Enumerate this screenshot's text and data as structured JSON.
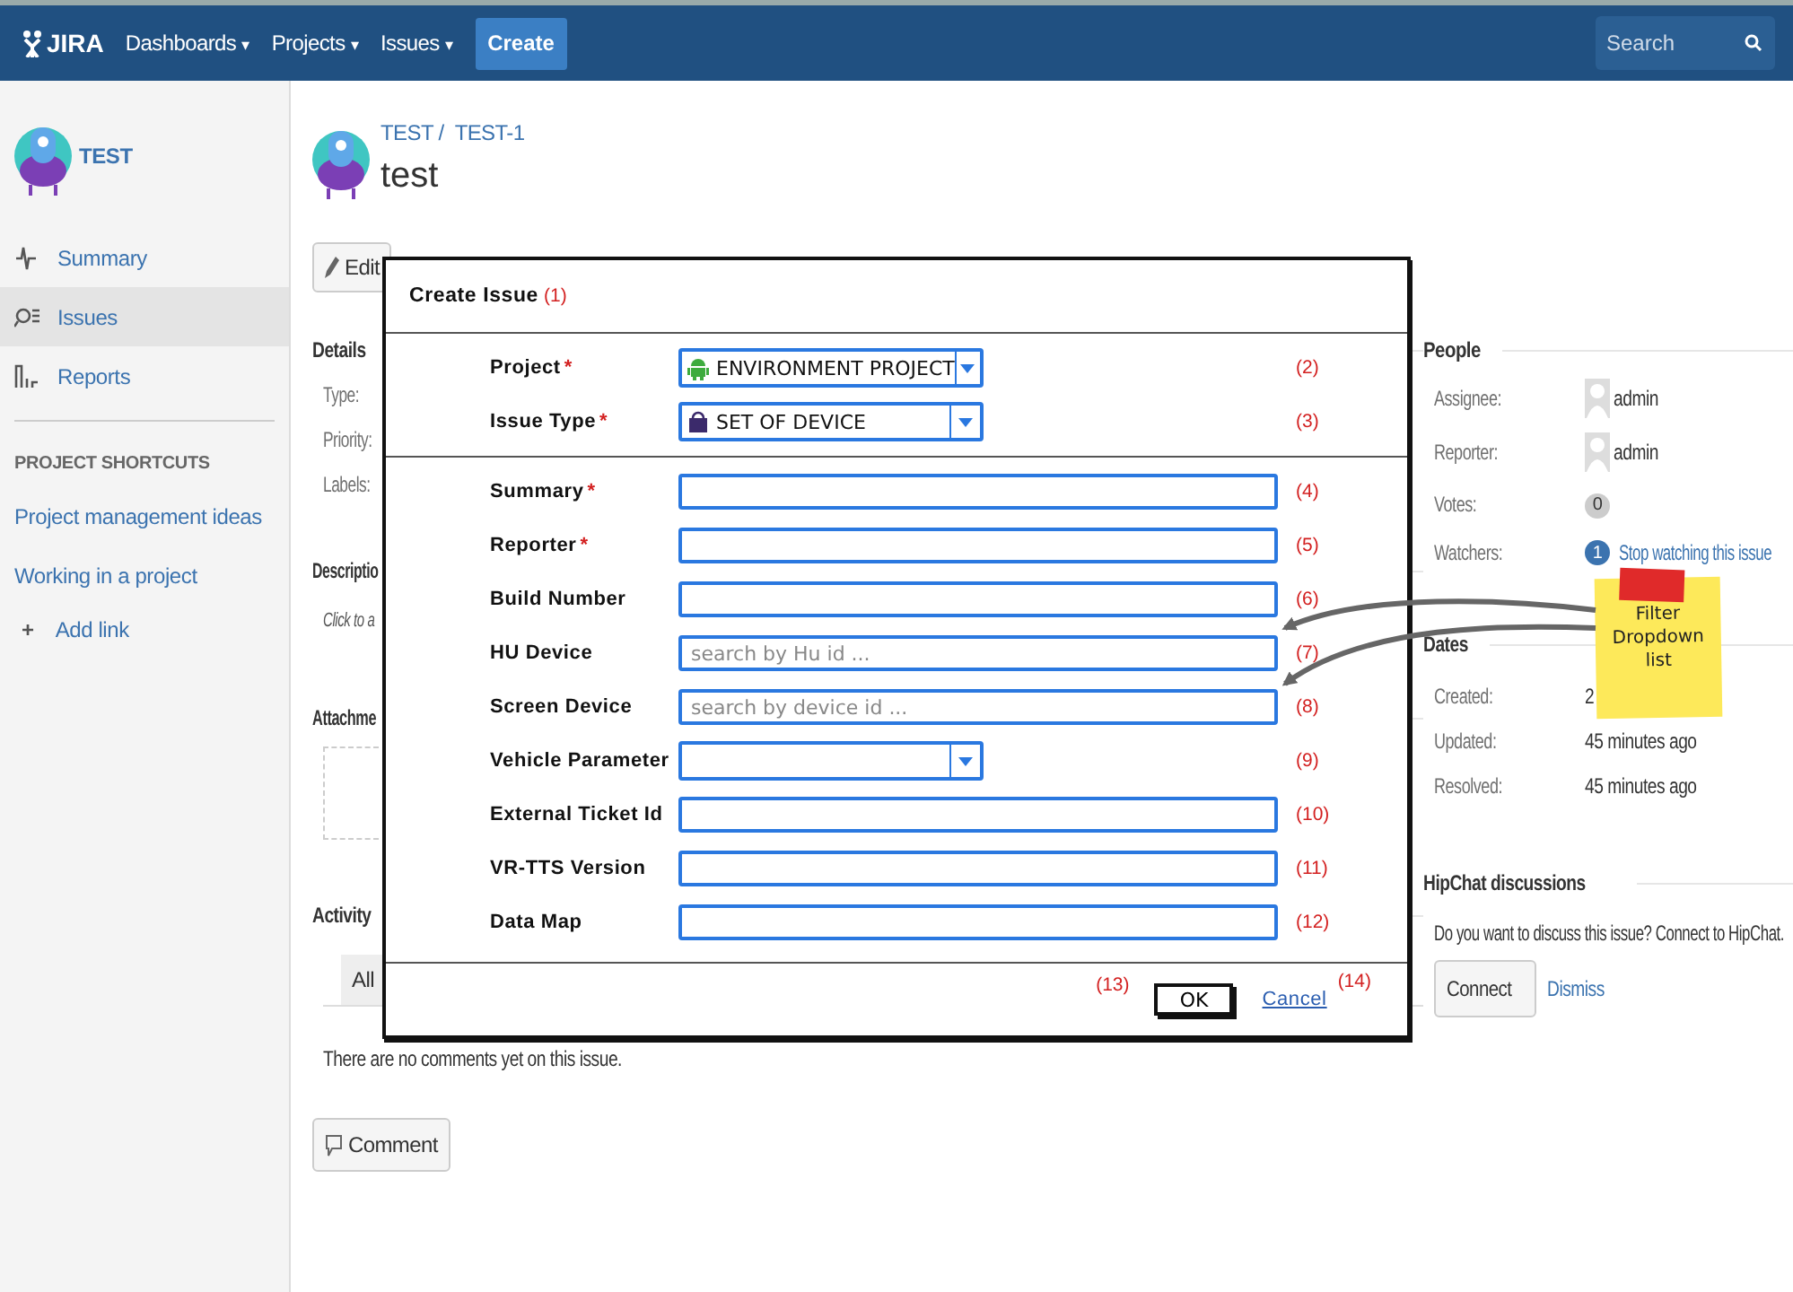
{
  "top_nav": {
    "logo": "JIRA",
    "menus": [
      {
        "label": "Dashboards",
        "caret": "▾"
      },
      {
        "label": "Projects",
        "caret": "▾"
      },
      {
        "label": "Issues",
        "caret": "▾"
      }
    ],
    "create_button": "Create",
    "search": {
      "placeholder": "Search"
    }
  },
  "sidebar": {
    "project_name": "TEST",
    "nav": [
      {
        "label": "Summary",
        "kind": "pulse",
        "selected": false
      },
      {
        "label": "Issues",
        "kind": "search",
        "selected": true
      },
      {
        "label": "Reports",
        "kind": "chart",
        "selected": false
      }
    ],
    "shortcuts_heading": "PROJECT SHORTCUTS",
    "shortcuts": [
      "Project management ideas",
      "Working in a project"
    ],
    "add_link": {
      "icon": "+",
      "label": "Add link"
    }
  },
  "issue": {
    "breadcrumb": {
      "project": "TEST",
      "separator": "/",
      "key": "TEST-1"
    },
    "title": "test",
    "toolbar": [
      "Edit"
    ],
    "details": {
      "heading": "Details",
      "labels": [
        "Type:",
        "Priority:",
        "Labels:"
      ]
    },
    "description": {
      "heading": "Descriptio",
      "prompt": "Click to a"
    },
    "attachments": {
      "heading": "Attachme"
    },
    "activity": {
      "heading": "Activity",
      "tabs": [
        {
          "label": "All",
          "selected": true
        }
      ],
      "message": "There are no comments yet on this issue.",
      "comment_button": "Comment"
    },
    "people": {
      "heading": "People",
      "rows": [
        {
          "label": "Assignee:",
          "kind": "user",
          "value": "admin"
        },
        {
          "label": "Reporter:",
          "kind": "user",
          "value": "admin"
        },
        {
          "label": "Votes:",
          "kind": "count",
          "value": "0"
        },
        {
          "label": "Watchers:",
          "kind": "watch",
          "badge": "1",
          "value": "Stop watching this issue"
        }
      ]
    },
    "dates": {
      "heading": "Dates",
      "rows": [
        {
          "label": "Created:",
          "value": "2"
        },
        {
          "label": "Updated:",
          "value": "45 minutes ago"
        },
        {
          "label": "Resolved:",
          "value": "45 minutes ago"
        }
      ]
    },
    "hipchat": {
      "heading": "HipChat discussions",
      "text": "Do you want to discuss this issue? Connect to HipChat.",
      "connect_button": "Connect",
      "dismiss_link": "Dismiss"
    }
  },
  "dialog": {
    "title": "Create Issue",
    "title_note": "(1)",
    "sections": [
      [
        {
          "label": "Project",
          "required_mark": "*",
          "kind": "select",
          "value": "ENVIRONMENT PROJECT",
          "note": "(2)"
        },
        {
          "label": "Issue Type",
          "required_mark": "*",
          "kind": "select",
          "value": "SET OF DEVICE",
          "note": "(3)"
        }
      ],
      [
        {
          "label": "Summary",
          "required_mark": "*",
          "kind": "text",
          "note": "(4)"
        },
        {
          "label": "Reporter",
          "required_mark": "*",
          "kind": "text",
          "note": "(5)"
        },
        {
          "label": "Build Number",
          "kind": "text",
          "note": "(6)"
        },
        {
          "label": "HU Device",
          "kind": "text",
          "placeholder": "search by Hu id ...",
          "note": "(7)"
        },
        {
          "label": "Screen Device",
          "kind": "text",
          "placeholder": "search by device id ...",
          "note": "(8)"
        },
        {
          "label": "Vehicle Parameter",
          "kind": "select",
          "note": "(9)"
        },
        {
          "label": "External Ticket Id",
          "kind": "text",
          "note": "(10)"
        },
        {
          "label": "VR-TTS Version",
          "kind": "text",
          "note": "(11)"
        },
        {
          "label": "Data Map",
          "kind": "text",
          "note": "(12)"
        }
      ]
    ],
    "ok_note": "(13)",
    "ok_button": "OK",
    "cancel_link": "Cancel",
    "cancel_note": "(14)"
  },
  "sticky_note": {
    "text": "Filter Dropdown list"
  }
}
